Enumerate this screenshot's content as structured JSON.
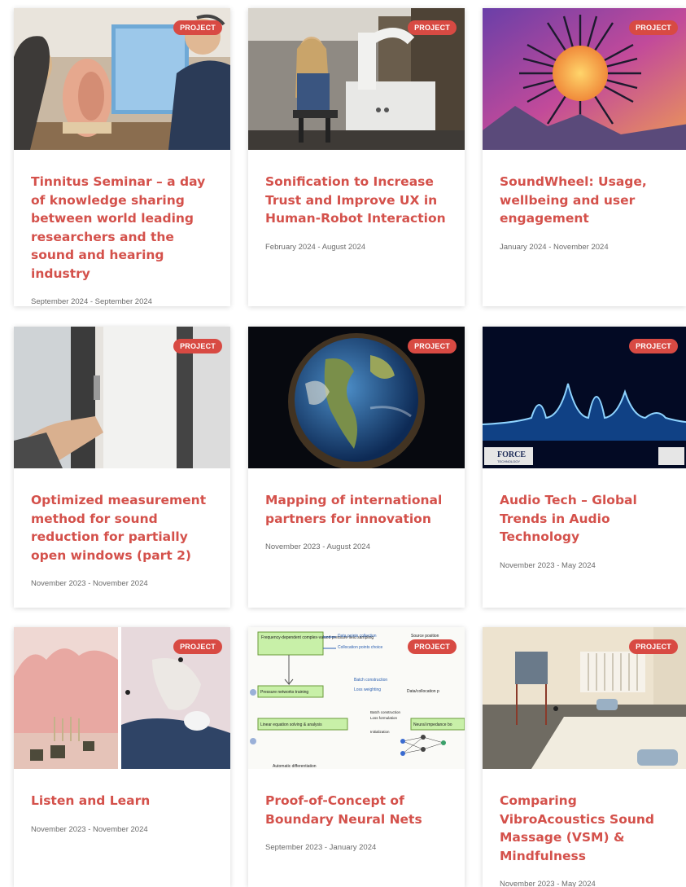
{
  "badge_label": "PROJECT",
  "accent_color": "#d4514b",
  "badge_color": "#d84a43",
  "cards": [
    {
      "title": "Tinnitus Seminar – a day of knowledge sharing between world leading researchers and the sound and hearing industry",
      "date": "September 2024 - September 2024"
    },
    {
      "title": "Sonification to Increase Trust and Improve UX in Human-Robot Interaction",
      "date": "February 2024 - August 2024"
    },
    {
      "title": "SoundWheel: Usage, wellbeing and user engagement",
      "date": "January 2024 - November 2024"
    },
    {
      "title": "Optimized measurement method for sound reduction for partially open windows (part 2)",
      "date": "November 2023 - November 2024"
    },
    {
      "title": "Mapping of international partners for innovation",
      "date": "November 2023 - August 2024"
    },
    {
      "title": "Audio Tech – Global Trends in Audio Technology",
      "date": "November 2023 - May 2024"
    },
    {
      "title": "Listen and Learn",
      "date": "November 2023 - November 2024"
    },
    {
      "title": "Proof-of-Concept of Boundary Neural Nets",
      "date": "September 2023 - January 2024"
    },
    {
      "title": "Comparing VibroAcoustics Sound Massage (VSM) & Mindfulness",
      "date": "November 2023 - May 2024"
    }
  ],
  "image_text": {
    "force_logo": "FORCE",
    "force_sub": "TECHNOLOGY",
    "diagram": {
      "box1": "Frequency-dependent complex-valued pressure field sampling",
      "data_points": "Data points collection",
      "collocation": "Collocation points choice",
      "source_position": "Source position",
      "batch": "Batch construction",
      "loss": "Loss weighting",
      "pressure_networks": "Pressure networks training",
      "data_collocation": "Data/collocation p",
      "linear_eq": "Linear equation solving & analysis",
      "neural_impedance": "Neural impedance bo",
      "batch2": "Batch construction",
      "loss2": "Loss formulation",
      "init": "Initialization",
      "autodiff": "Automatic differentiation"
    }
  }
}
